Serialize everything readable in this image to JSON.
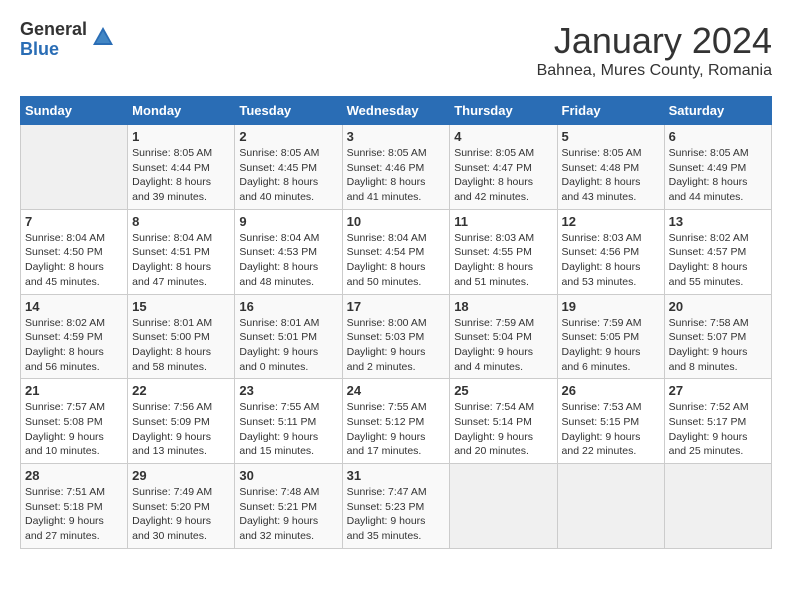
{
  "logo": {
    "general": "General",
    "blue": "Blue"
  },
  "title": "January 2024",
  "subtitle": "Bahnea, Mures County, Romania",
  "days_header": [
    "Sunday",
    "Monday",
    "Tuesday",
    "Wednesday",
    "Thursday",
    "Friday",
    "Saturday"
  ],
  "weeks": [
    [
      {
        "day": "",
        "sunrise": "",
        "sunset": "",
        "daylight": ""
      },
      {
        "day": "1",
        "sunrise": "Sunrise: 8:05 AM",
        "sunset": "Sunset: 4:44 PM",
        "daylight": "Daylight: 8 hours and 39 minutes."
      },
      {
        "day": "2",
        "sunrise": "Sunrise: 8:05 AM",
        "sunset": "Sunset: 4:45 PM",
        "daylight": "Daylight: 8 hours and 40 minutes."
      },
      {
        "day": "3",
        "sunrise": "Sunrise: 8:05 AM",
        "sunset": "Sunset: 4:46 PM",
        "daylight": "Daylight: 8 hours and 41 minutes."
      },
      {
        "day": "4",
        "sunrise": "Sunrise: 8:05 AM",
        "sunset": "Sunset: 4:47 PM",
        "daylight": "Daylight: 8 hours and 42 minutes."
      },
      {
        "day": "5",
        "sunrise": "Sunrise: 8:05 AM",
        "sunset": "Sunset: 4:48 PM",
        "daylight": "Daylight: 8 hours and 43 minutes."
      },
      {
        "day": "6",
        "sunrise": "Sunrise: 8:05 AM",
        "sunset": "Sunset: 4:49 PM",
        "daylight": "Daylight: 8 hours and 44 minutes."
      }
    ],
    [
      {
        "day": "7",
        "sunrise": "Sunrise: 8:04 AM",
        "sunset": "Sunset: 4:50 PM",
        "daylight": "Daylight: 8 hours and 45 minutes."
      },
      {
        "day": "8",
        "sunrise": "Sunrise: 8:04 AM",
        "sunset": "Sunset: 4:51 PM",
        "daylight": "Daylight: 8 hours and 47 minutes."
      },
      {
        "day": "9",
        "sunrise": "Sunrise: 8:04 AM",
        "sunset": "Sunset: 4:53 PM",
        "daylight": "Daylight: 8 hours and 48 minutes."
      },
      {
        "day": "10",
        "sunrise": "Sunrise: 8:04 AM",
        "sunset": "Sunset: 4:54 PM",
        "daylight": "Daylight: 8 hours and 50 minutes."
      },
      {
        "day": "11",
        "sunrise": "Sunrise: 8:03 AM",
        "sunset": "Sunset: 4:55 PM",
        "daylight": "Daylight: 8 hours and 51 minutes."
      },
      {
        "day": "12",
        "sunrise": "Sunrise: 8:03 AM",
        "sunset": "Sunset: 4:56 PM",
        "daylight": "Daylight: 8 hours and 53 minutes."
      },
      {
        "day": "13",
        "sunrise": "Sunrise: 8:02 AM",
        "sunset": "Sunset: 4:57 PM",
        "daylight": "Daylight: 8 hours and 55 minutes."
      }
    ],
    [
      {
        "day": "14",
        "sunrise": "Sunrise: 8:02 AM",
        "sunset": "Sunset: 4:59 PM",
        "daylight": "Daylight: 8 hours and 56 minutes."
      },
      {
        "day": "15",
        "sunrise": "Sunrise: 8:01 AM",
        "sunset": "Sunset: 5:00 PM",
        "daylight": "Daylight: 8 hours and 58 minutes."
      },
      {
        "day": "16",
        "sunrise": "Sunrise: 8:01 AM",
        "sunset": "Sunset: 5:01 PM",
        "daylight": "Daylight: 9 hours and 0 minutes."
      },
      {
        "day": "17",
        "sunrise": "Sunrise: 8:00 AM",
        "sunset": "Sunset: 5:03 PM",
        "daylight": "Daylight: 9 hours and 2 minutes."
      },
      {
        "day": "18",
        "sunrise": "Sunrise: 7:59 AM",
        "sunset": "Sunset: 5:04 PM",
        "daylight": "Daylight: 9 hours and 4 minutes."
      },
      {
        "day": "19",
        "sunrise": "Sunrise: 7:59 AM",
        "sunset": "Sunset: 5:05 PM",
        "daylight": "Daylight: 9 hours and 6 minutes."
      },
      {
        "day": "20",
        "sunrise": "Sunrise: 7:58 AM",
        "sunset": "Sunset: 5:07 PM",
        "daylight": "Daylight: 9 hours and 8 minutes."
      }
    ],
    [
      {
        "day": "21",
        "sunrise": "Sunrise: 7:57 AM",
        "sunset": "Sunset: 5:08 PM",
        "daylight": "Daylight: 9 hours and 10 minutes."
      },
      {
        "day": "22",
        "sunrise": "Sunrise: 7:56 AM",
        "sunset": "Sunset: 5:09 PM",
        "daylight": "Daylight: 9 hours and 13 minutes."
      },
      {
        "day": "23",
        "sunrise": "Sunrise: 7:55 AM",
        "sunset": "Sunset: 5:11 PM",
        "daylight": "Daylight: 9 hours and 15 minutes."
      },
      {
        "day": "24",
        "sunrise": "Sunrise: 7:55 AM",
        "sunset": "Sunset: 5:12 PM",
        "daylight": "Daylight: 9 hours and 17 minutes."
      },
      {
        "day": "25",
        "sunrise": "Sunrise: 7:54 AM",
        "sunset": "Sunset: 5:14 PM",
        "daylight": "Daylight: 9 hours and 20 minutes."
      },
      {
        "day": "26",
        "sunrise": "Sunrise: 7:53 AM",
        "sunset": "Sunset: 5:15 PM",
        "daylight": "Daylight: 9 hours and 22 minutes."
      },
      {
        "day": "27",
        "sunrise": "Sunrise: 7:52 AM",
        "sunset": "Sunset: 5:17 PM",
        "daylight": "Daylight: 9 hours and 25 minutes."
      }
    ],
    [
      {
        "day": "28",
        "sunrise": "Sunrise: 7:51 AM",
        "sunset": "Sunset: 5:18 PM",
        "daylight": "Daylight: 9 hours and 27 minutes."
      },
      {
        "day": "29",
        "sunrise": "Sunrise: 7:49 AM",
        "sunset": "Sunset: 5:20 PM",
        "daylight": "Daylight: 9 hours and 30 minutes."
      },
      {
        "day": "30",
        "sunrise": "Sunrise: 7:48 AM",
        "sunset": "Sunset: 5:21 PM",
        "daylight": "Daylight: 9 hours and 32 minutes."
      },
      {
        "day": "31",
        "sunrise": "Sunrise: 7:47 AM",
        "sunset": "Sunset: 5:23 PM",
        "daylight": "Daylight: 9 hours and 35 minutes."
      },
      {
        "day": "",
        "sunrise": "",
        "sunset": "",
        "daylight": ""
      },
      {
        "day": "",
        "sunrise": "",
        "sunset": "",
        "daylight": ""
      },
      {
        "day": "",
        "sunrise": "",
        "sunset": "",
        "daylight": ""
      }
    ]
  ]
}
